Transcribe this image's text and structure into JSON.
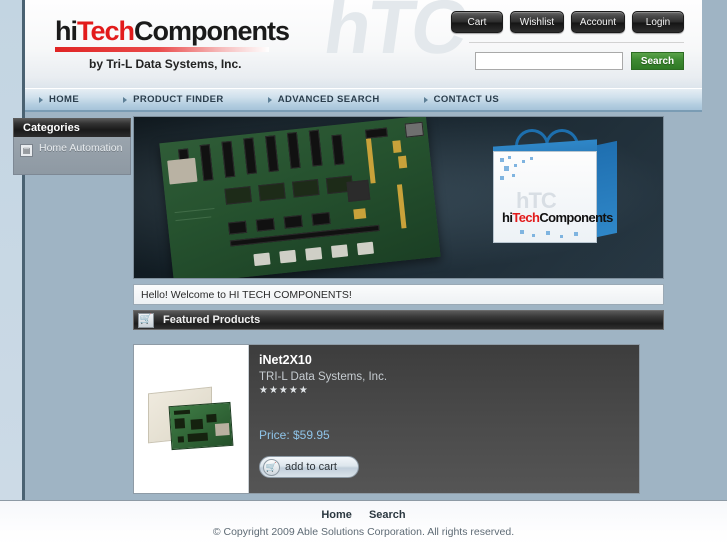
{
  "site": {
    "logo_hi": "hi",
    "logo_tech": "Tech",
    "logo_components": "Components",
    "tagline": "by Tri-L Data Systems, Inc.",
    "watermark": "hTC"
  },
  "header": {
    "buttons": [
      {
        "label": "Cart",
        "name": "cart-button"
      },
      {
        "label": "Wishlist",
        "name": "wishlist-button"
      },
      {
        "label": "Account",
        "name": "account-button"
      },
      {
        "label": "Login",
        "name": "login-button"
      }
    ],
    "search": {
      "value": "",
      "placeholder": "",
      "button_label": "Search"
    }
  },
  "nav": {
    "items": [
      {
        "label": "HOME"
      },
      {
        "label": "PRODUCT FINDER"
      },
      {
        "label": "ADVANCED SEARCH"
      },
      {
        "label": "CONTACT US"
      }
    ]
  },
  "sidebar": {
    "title": "Categories",
    "items": [
      {
        "label": "Home Automation",
        "icon": "category-icon",
        "glyph": "▤"
      }
    ]
  },
  "banner": {
    "bag_watermark": "hTC",
    "bag_logo_hi": "hi",
    "bag_logo_tech": "Tech",
    "bag_logo_components": "Components"
  },
  "welcome": {
    "message": "Hello! Welcome to HI TECH COMPONENTS!"
  },
  "featured": {
    "title": "Featured Products",
    "icon": "shopping-cart-icon",
    "icon_glyph": "🛒"
  },
  "product": {
    "name": "iNet2X10",
    "brand": "TRI-L Data Systems, Inc.",
    "rating_stars": "★★★★★",
    "rating_value": 5,
    "price": "Price: $59.95",
    "add_to_cart_label": "add to cart",
    "add_to_cart_glyph": "🛒"
  },
  "footer": {
    "links": [
      {
        "label": "Home"
      },
      {
        "label": "Search"
      }
    ],
    "copyright": "© Copyright 2009 Able Solutions Corporation. All rights reserved."
  },
  "colors": {
    "accent_red": "#e21b1b",
    "search_green": "#3e8a32",
    "price_blue": "#8fc4e8",
    "page_blue": "#9fb4c4"
  }
}
